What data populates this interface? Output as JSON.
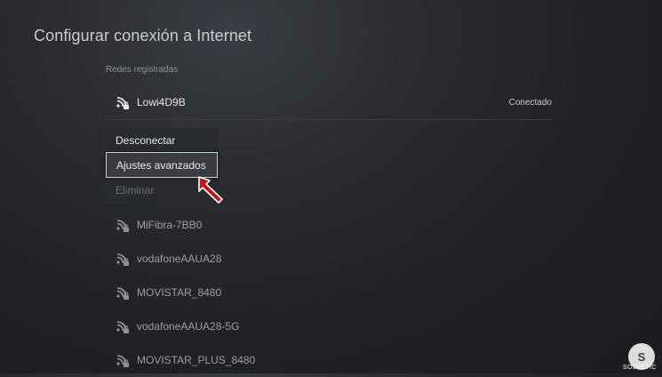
{
  "page_title": "Configurar conexión a Internet",
  "section_label": "Redes registradas",
  "connected_network": {
    "name": "Lowi4D9B",
    "status": "Conectado"
  },
  "context_menu": {
    "disconnect_label": "Desconectar",
    "advanced_label": "Ajustes avanzados",
    "delete_label": "Eliminar"
  },
  "networks": [
    {
      "name": "MiFibra-7BB0"
    },
    {
      "name": "vodafoneAAUA28"
    },
    {
      "name": "MOVISTAR_8480"
    },
    {
      "name": "vodafoneAAUA28-5G"
    },
    {
      "name": "MOVISTAR_PLUS_8480"
    }
  ],
  "watermark": {
    "letter": "S",
    "text": "SOLVETIC"
  },
  "colors": {
    "background": "#202226",
    "cursor": "#c0141a",
    "text": "#e6e6e6",
    "dim_text": "#9c9ea3"
  }
}
